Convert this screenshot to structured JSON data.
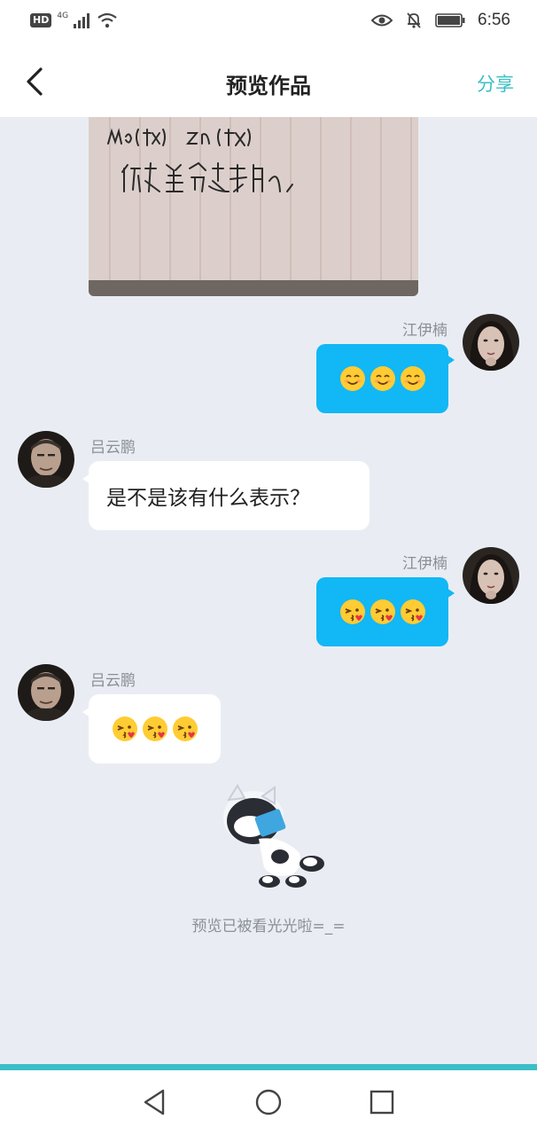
{
  "status_bar": {
    "badge": "HD",
    "network": "4G",
    "time": "6:56",
    "icons": [
      "hd-icon",
      "signal-icon",
      "wifi-icon",
      "eye-icon",
      "bell-off-icon",
      "battery-icon"
    ]
  },
  "header": {
    "title": "预览作品",
    "share_label": "分享",
    "back_icon": "chevron-left-icon"
  },
  "messages": [
    {
      "side": "right",
      "sender": "江伊楠",
      "content_type": "emoji",
      "emojis": [
        "smiling-face-emoji",
        "smiling-face-emoji",
        "smiling-face-emoji"
      ]
    },
    {
      "side": "left",
      "sender": "吕云鹏",
      "content_type": "text",
      "text": "是不是该有什么表示？"
    },
    {
      "side": "right",
      "sender": "江伊楠",
      "content_type": "emoji",
      "emojis": [
        "kissing-face-emoji",
        "kissing-face-emoji",
        "kissing-face-emoji"
      ]
    },
    {
      "side": "left",
      "sender": "吕云鹏",
      "content_type": "emoji",
      "emojis": [
        "kissing-face-emoji",
        "kissing-face-emoji",
        "kissing-face-emoji"
      ]
    }
  ],
  "end_note": "预览已被看光光啦=_=",
  "nav_bar": {
    "icons": [
      "back-triangle-icon",
      "home-circle-icon",
      "recents-square-icon"
    ]
  },
  "colors": {
    "accent": "#3bbfc7",
    "bubble_right": "#12b7f5",
    "background": "#e9edf3"
  }
}
